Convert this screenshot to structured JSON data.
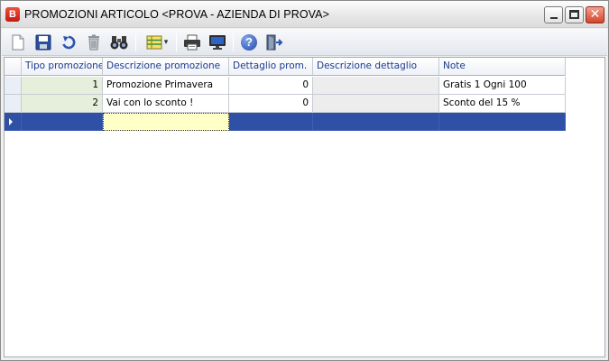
{
  "window": {
    "app_icon_letter": "B",
    "title": "PROMOZIONI ARTICOLO <PROVA - AZIENDA DI PROVA>",
    "close_glyph": "✕"
  },
  "toolbar": {
    "buttons": [
      {
        "name": "new-document-icon"
      },
      {
        "name": "save-icon"
      },
      {
        "name": "undo-icon"
      },
      {
        "name": "delete-icon"
      },
      {
        "name": "search-binoculars-icon"
      },
      {
        "name": "grid-options-icon"
      },
      {
        "name": "print-icon"
      },
      {
        "name": "preview-monitor-icon"
      },
      {
        "name": "help-icon"
      },
      {
        "name": "exit-icon"
      }
    ],
    "help_glyph": "?",
    "dropdown_glyph": "▾"
  },
  "grid": {
    "columns": [
      "Tipo promozione",
      "Descrizione promozione",
      "Dettaglio prom.",
      "Descrizione dettaglio",
      "Note"
    ],
    "rows": [
      {
        "tipo": "1",
        "descrizione": "Promozione Primavera",
        "dettaglio": "0",
        "descrizione_dettaglio": "",
        "note": "Gratis 1 Ogni 100"
      },
      {
        "tipo": "2",
        "descrizione": "Vai con lo sconto !",
        "dettaglio": "0",
        "descrizione_dettaglio": "",
        "note": "Sconto del 15 %"
      }
    ]
  },
  "colors": {
    "accent_blue": "#2e50a5",
    "header_text": "#1a3a8f",
    "key_column_fill": "#e6efdc",
    "focus_cell": "#ffffc8"
  }
}
